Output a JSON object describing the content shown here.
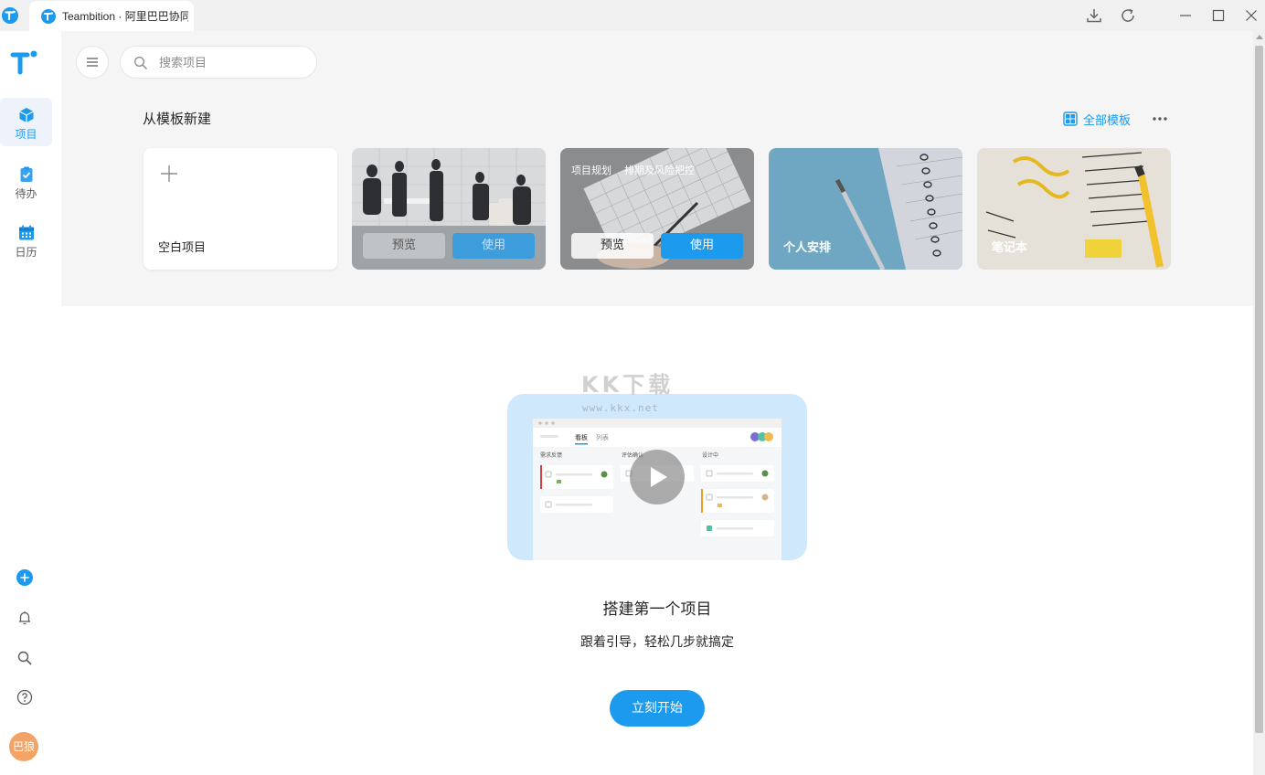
{
  "window": {
    "tab_title": "Teambition · 阿里巴巴协同"
  },
  "sidebar": {
    "items": [
      {
        "label": "项目",
        "icon": "project-cube-icon"
      },
      {
        "label": "待办",
        "icon": "todo-clipboard-icon"
      },
      {
        "label": "日历",
        "icon": "calendar-icon"
      }
    ],
    "tools": [
      "add-icon",
      "bell-icon",
      "search-icon",
      "help-icon"
    ],
    "avatar_text": "巴狼"
  },
  "header": {
    "search_placeholder": "搜索项目"
  },
  "templates": {
    "title": "从模板新建",
    "all_label": "全部模板",
    "cards": [
      {
        "label": "空白项目"
      },
      {
        "preview": "预览",
        "use": "使用"
      },
      {
        "top_left": "项目规划",
        "top_right": "排期及风险把控",
        "preview": "预览",
        "use": "使用"
      },
      {
        "label": "个人安排"
      },
      {
        "label": "笔记本"
      }
    ]
  },
  "empty_state": {
    "watermark": "KK下载",
    "watermark_url": "www.kkx.net",
    "title": "搭建第一个项目",
    "description": "跟着引导，轻松几步就搞定",
    "button": "立刻开始",
    "mock": {
      "tabs": [
        "看板",
        "列表"
      ],
      "columns": [
        "需求反馈",
        "评估确认",
        "设计中"
      ]
    }
  },
  "colors": {
    "accent": "#1b9aee",
    "panel_bg": "#f5f5f5",
    "illustration_bg": "#cfe8fc"
  }
}
